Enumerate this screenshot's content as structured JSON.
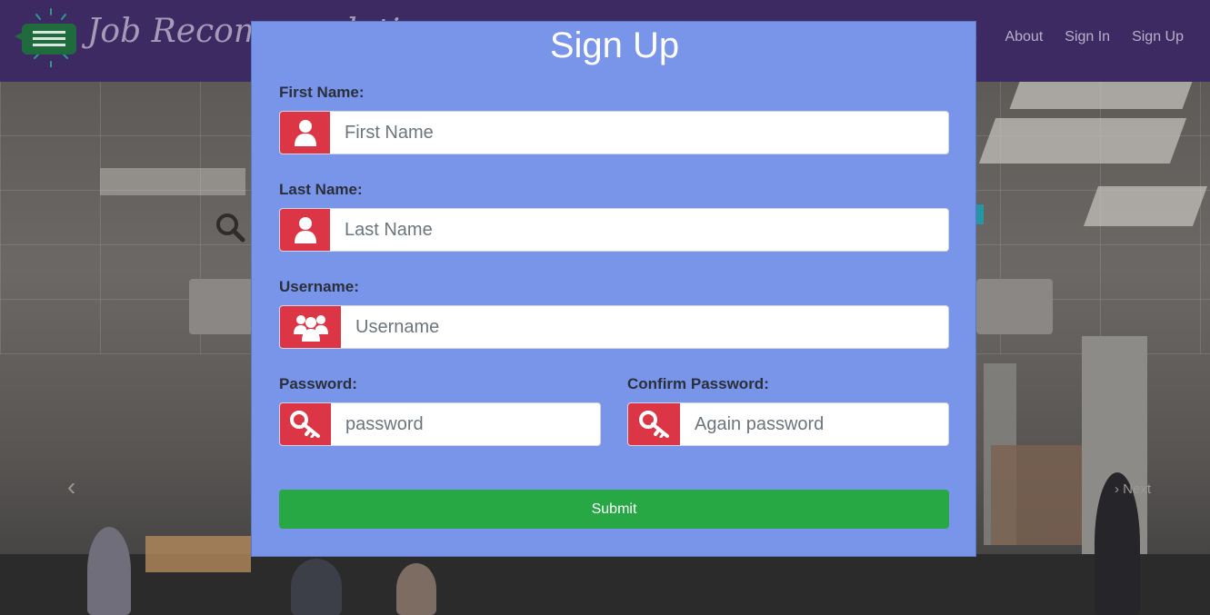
{
  "navbar": {
    "brand": "Job Recommendation",
    "partial_link": "e",
    "links": [
      {
        "label": "About"
      },
      {
        "label": "Sign In"
      },
      {
        "label": "Sign Up"
      }
    ]
  },
  "hero": {
    "prev_label": "‹",
    "next_label": "› Next"
  },
  "modal": {
    "title": "Sign Up",
    "first_name": {
      "label": "First Name:",
      "placeholder": "First Name",
      "icon": "user-icon"
    },
    "last_name": {
      "label": "Last Name:",
      "placeholder": "Last Name",
      "icon": "user-icon"
    },
    "username": {
      "label": "Username:",
      "placeholder": "Username",
      "icon": "users-icon"
    },
    "password": {
      "label": "Password:",
      "placeholder": "password",
      "icon": "key-icon"
    },
    "confirm_password": {
      "label": "Confirm Password:",
      "placeholder": "Again password",
      "icon": "key-icon"
    },
    "submit_label": "Submit"
  },
  "colors": {
    "navbar": "#3e2a63",
    "modal_bg": "#7895ea",
    "addon": "#dc3545",
    "submit": "#28a745"
  }
}
